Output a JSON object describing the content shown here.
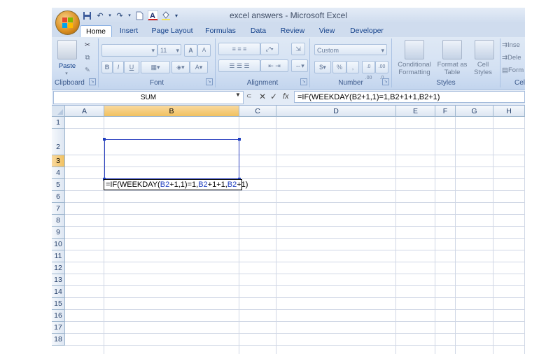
{
  "window": {
    "title": "excel answers - Microsoft Excel"
  },
  "qat": {
    "icons": [
      "save-icon",
      "undo-icon",
      "redo-icon",
      "new-icon",
      "font-color-icon",
      "fill-color-icon",
      "customize-icon"
    ]
  },
  "tabs": [
    "Home",
    "Insert",
    "Page Layout",
    "Formulas",
    "Data",
    "Review",
    "View",
    "Developer"
  ],
  "ribbon": {
    "clipboard": {
      "label": "Clipboard",
      "paste": "Paste"
    },
    "font": {
      "label": "Font",
      "size": "11",
      "bold": "B",
      "italic": "I",
      "underline": "U",
      "grow": "A",
      "shrink": "A"
    },
    "alignment": {
      "label": "Alignment"
    },
    "number": {
      "label": "Number",
      "format": "Custom",
      "currency": "$",
      "percent": "%",
      "comma": ",",
      "inc_dec": ".0 .00",
      "dec_dec": ".00 .0"
    },
    "styles": {
      "label": "Styles",
      "conditional": "Conditional Formatting",
      "format_table": "Format as Table",
      "cell_styles": "Cell Styles"
    },
    "cells": {
      "label": "Cell",
      "insert": "Inse",
      "delete": "Dele",
      "format": "Form"
    }
  },
  "formula_bar": {
    "name_box": "SUM",
    "formula": "=IF(WEEKDAY(B2+1,1)=1,B2+1+1,B2+1)",
    "fx": "fx",
    "cancel": "✕",
    "enter": "✓"
  },
  "columns": [
    "A",
    "B",
    "C",
    "D",
    "E",
    "F",
    "G",
    "H"
  ],
  "selected_column": "B",
  "rows": [
    "1",
    "2",
    "3",
    "4",
    "5",
    "6",
    "7",
    "8",
    "9",
    "10",
    "11",
    "12",
    "13",
    "14",
    "15",
    "16",
    "17",
    "18"
  ],
  "selected_row": "3",
  "edit_cell": {
    "address": "B3",
    "parts": [
      "=IF(WEEKDAY(",
      "B2",
      "+1,1)=1,",
      "B2",
      "+1+1,",
      "B2",
      "+1)"
    ]
  },
  "colors": {
    "accent": "#15428b",
    "selected_header": "#f1c15f",
    "reference": "#1f3fbf"
  }
}
